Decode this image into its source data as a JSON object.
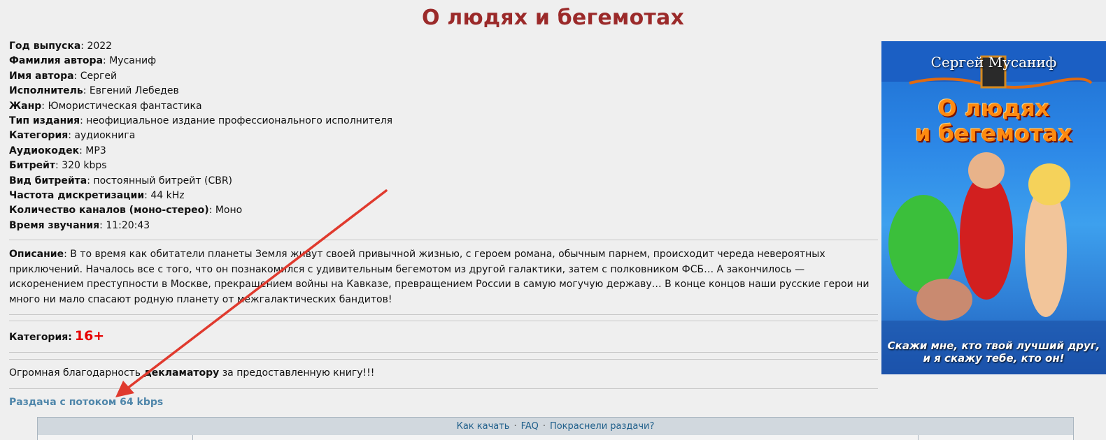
{
  "title": "О людях и бегемотах",
  "info": [
    {
      "label": "Год выпуска",
      "value": ": 2022"
    },
    {
      "label": "Фамилия автора",
      "value": ": Мусаниф"
    },
    {
      "label": "Имя автора",
      "value": ": Сергей"
    },
    {
      "label": "Исполнитель",
      "value": ": Евгений Лебедев"
    },
    {
      "label": "Жанр",
      "value": ": Юмористическая фантастика"
    },
    {
      "label": "Тип издания",
      "value": ": неофициальное издание профессионального исполнителя"
    },
    {
      "label": "Категория",
      "value": ": аудиокнига"
    },
    {
      "label": "Аудиокодек",
      "value": ": MP3"
    },
    {
      "label": "Битрейт",
      "value": ": 320 kbps"
    },
    {
      "label": "Вид битрейта",
      "value": ": постоянный битрейт (CBR)"
    },
    {
      "label": "Частота дискретизации",
      "value": ": 44 kHz"
    },
    {
      "label": "Количество каналов (моно-стерео)",
      "value": ": Моно"
    },
    {
      "label": "Время звучания",
      "value": ": 11:20:43"
    }
  ],
  "description": {
    "label": "Описание",
    "text": ": В то время как обитатели планеты Земля живут своей привычной жизнью, с героем романа, обычным парнем, происходит череда невероятных приключений. Началось все с того, что он познакомился с удивительным бегемотом из другой галактики, затем с полковником ФСБ… А закончилось — искоренением преступности в Москве, прекращением войны на Кавказе, превращением России в самую могучую державу… В конце концов наши русские герои ни много ни мало спасают родную планету от межгалактических бандитов!"
  },
  "age_category": {
    "label": "Категория:",
    "value": "16+"
  },
  "thanks": {
    "before": "Огромная благодарность ",
    "bold": "декламатору",
    "after": " за предоставленную книгу!!!"
  },
  "distribution_link": "Раздача с потоком 64 kbps",
  "cover": {
    "author": "Сергей Мусаниф",
    "title_line1": "О людях",
    "title_line2": "и бегемотах",
    "quote_line1": "Скажи мне, кто твой лучший друг,",
    "quote_line2": "и я скажу тебе, кто он!"
  },
  "toolbar": {
    "how_to": "Как качать",
    "faq": "FAQ",
    "sep": "·",
    "red_torrents": "Покраснели раздачи?"
  },
  "colors": {
    "title": "#9b2a2a",
    "link": "#4f86aa",
    "age": "#e60000",
    "arrow": "#e03a2e"
  }
}
